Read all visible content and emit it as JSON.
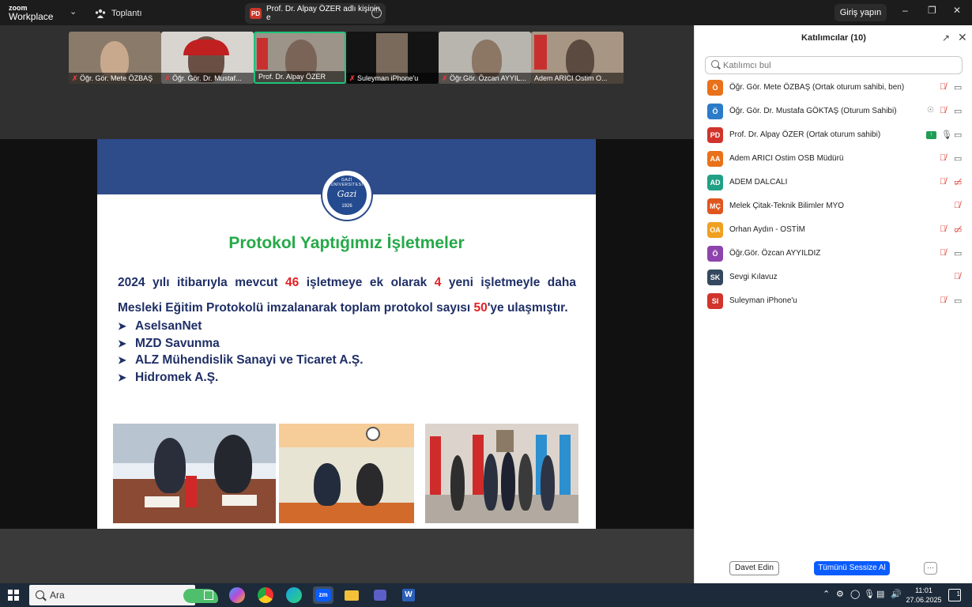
{
  "app": {
    "logo_line1": "zoom",
    "logo_line2": "Workplace",
    "meeting_tab_label": "Toplantı",
    "share_tab_badge": "PD",
    "share_tab_label": "Prof. Dr. Alpay ÖZER adlı kişinin e",
    "signin_label": "Giriş yapın"
  },
  "video_tiles": [
    {
      "name": "Öğr. Gör. Mete ÖZBAŞ",
      "muted": true
    },
    {
      "name": "Öğr. Gör. Dr. Mustaf...",
      "muted": true
    },
    {
      "name": "Prof. Dr. Alpay ÖZER",
      "muted": false
    },
    {
      "name": "Suleyman iPhone'u",
      "muted": true
    },
    {
      "name": "Öğr.Gör. Özcan AYYIL...",
      "muted": true
    },
    {
      "name": "Adem ARICI Ostim O...",
      "muted": false
    }
  ],
  "slide": {
    "title": "Protokol Yaptığımız İşletmeler",
    "para_p1": "2024 yılı itibarıyla mevcut ",
    "para_n1": "46",
    "para_p2": " işletmeye ek olarak ",
    "para_n2": "4",
    "para_p3": " yeni işletmeyle daha Mesleki Eğitim Protokolü imzalanarak toplam protokol sayısı ",
    "para_n3": "50",
    "para_p4": "'ye ulaşmıştır.",
    "bullets": [
      "AselsanNet",
      "MZD Savunma",
      "ALZ Mühendislik Sanayi ve Ticaret A.Ş.",
      "Hidromek A.Ş."
    ],
    "seal_ring_text": "GAZİ ÜNİVERSİTESİ",
    "seal_signature": "Gazi",
    "seal_year": "1926",
    "colors": {
      "band": "#2e4b8a",
      "title": "#25a948",
      "text": "#1f2f66",
      "highlight": "#e31e24"
    }
  },
  "panel": {
    "title": "Katılımcılar (10)",
    "search_placeholder": "Katılımcı bul",
    "participants": [
      {
        "initials": "Ö",
        "color": "#e8711a",
        "name": "Öğr. Gör. Mete ÖZBAŞ (Ortak oturum sahibi, ben)",
        "mic": "off",
        "cam": "on"
      },
      {
        "initials": "Ö",
        "color": "#2c7bc9",
        "name": "Öğr. Gör. Dr. Mustafa GÖKTAŞ (Oturum Sahibi)",
        "mic": "off",
        "cam": "on",
        "recording": true
      },
      {
        "initials": "PD",
        "color": "#d0342c",
        "name": "Prof. Dr. Alpay ÖZER (Ortak oturum sahibi)",
        "mic": "on",
        "cam": "on",
        "sharing": true
      },
      {
        "initials": "AA",
        "color": "#e8711a",
        "name": "Adem ARICI Ostim OSB Müdürü",
        "mic": "off",
        "cam": "on"
      },
      {
        "initials": "AD",
        "color": "#21a085",
        "name": "ADEM DALCALI",
        "mic": "off",
        "cam": "off"
      },
      {
        "initials": "MÇ",
        "color": "#e0561f",
        "name": "Melek Çitak-Teknik Bilimler MYO",
        "mic": "off",
        "cam": "none"
      },
      {
        "initials": "OA",
        "color": "#f0a020",
        "name": "Orhan Aydın - OSTİM",
        "mic": "off",
        "cam": "off"
      },
      {
        "initials": "Ö",
        "color": "#8e44ad",
        "name": "Öğr.Gör. Özcan AYYILDIZ",
        "mic": "off",
        "cam": "on"
      },
      {
        "initials": "SK",
        "color": "#34495e",
        "name": "Sevgi Kılavuz",
        "mic": "off",
        "cam": "none"
      },
      {
        "initials": "SI",
        "color": "#d0342c",
        "name": "Suleyman iPhone'u",
        "mic": "off",
        "cam": "on"
      }
    ],
    "invite_label": "Davet Edin",
    "mute_all_label": "Tümünü Sessize Al",
    "more_label": "···"
  },
  "taskbar": {
    "search_placeholder": "Ara",
    "time": "11:01",
    "date": "27.06.2025",
    "notification_count": "1"
  }
}
